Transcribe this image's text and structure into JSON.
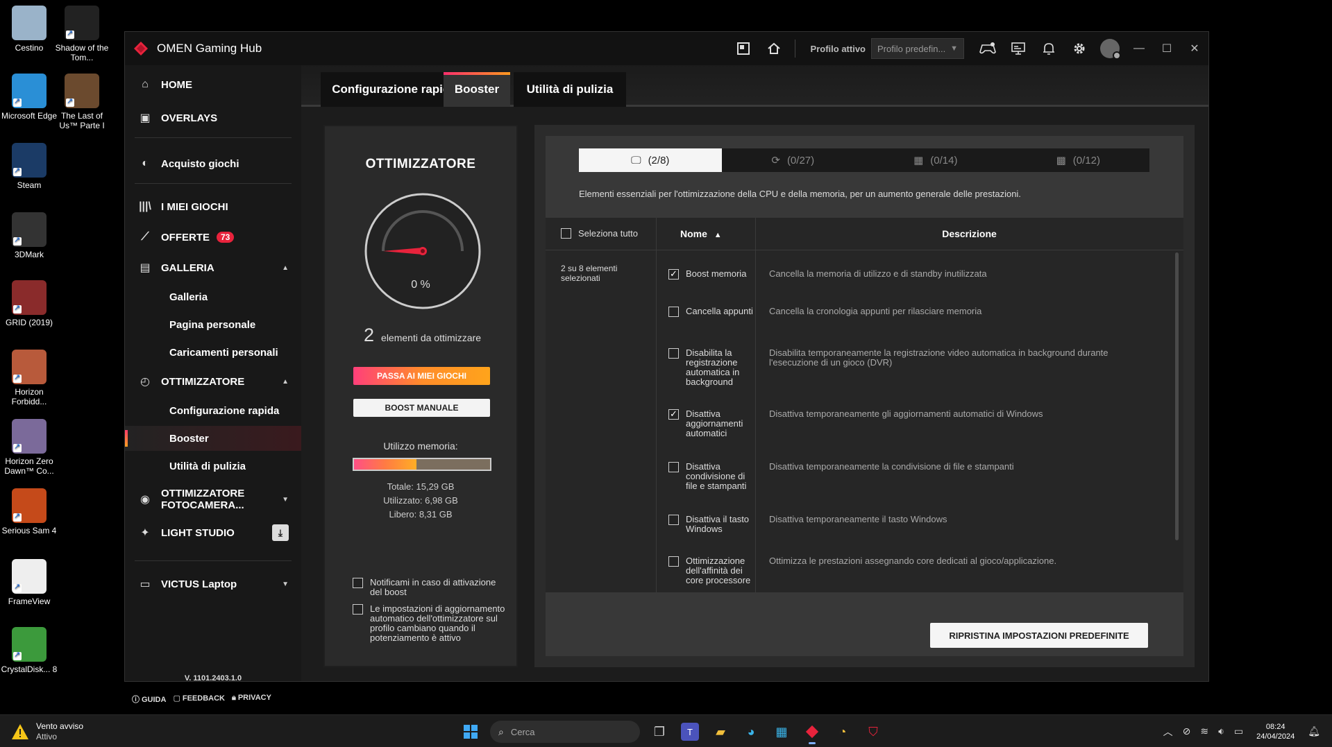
{
  "desktop": {
    "icons": [
      {
        "label": "Cestino",
        "color": "#9ab3c9"
      },
      {
        "label": "Shadow of the Tom...",
        "color": "#222"
      },
      {
        "label": "Microsoft Edge",
        "color": "#2a8fd6"
      },
      {
        "label": "The Last of Us™ Parte I",
        "color": "#6b4a2e"
      },
      {
        "label": "Steam",
        "color": "#1b3b66"
      },
      {
        "label": "3DMark",
        "color": "#333"
      },
      {
        "label": "GRID (2019)",
        "color": "#8a2b2b"
      },
      {
        "label": "Horizon Forbidd...",
        "color": "#b85a3b"
      },
      {
        "label": "Horizon Zero Dawn™ Co...",
        "color": "#7b6a9a"
      },
      {
        "label": "Serious Sam 4",
        "color": "#c54a1a"
      },
      {
        "label": "FrameView",
        "color": "#eee"
      },
      {
        "label": "CrystalDisk... 8",
        "color": "#3c9a3c"
      }
    ]
  },
  "window": {
    "title": "OMEN Gaming Hub",
    "profile_label": "Profilo attivo",
    "profile_value": "Profilo predefin..."
  },
  "sidebar": {
    "home": "HOME",
    "overlays": "OVERLAYS",
    "acquisto": "Acquisto giochi",
    "miei_giochi": "I MIEI GIOCHI",
    "offerte": "OFFERTE",
    "offerte_badge": "73",
    "galleria": "GALLERIA",
    "galleria_sub": [
      "Galleria",
      "Pagina personale",
      "Caricamenti personali"
    ],
    "ottimizzatore": "OTTIMIZZATORE",
    "ottimizzatore_sub": [
      "Configurazione rapida",
      "Booster",
      "Utilità di pulizia"
    ],
    "fotocamera_1": "OTTIMIZZATORE",
    "fotocamera_2": "FOTOCAMERA...",
    "light_studio": "LIGHT STUDIO",
    "device": "VICTUS Laptop",
    "version": "V. 1101.2403.1.0",
    "guida": "GUIDA",
    "feedback": "FEEDBACK",
    "privacy": "PRIVACY"
  },
  "tabs": [
    "Configurazione rapida",
    "Booster",
    "Utilità di pulizia"
  ],
  "optimizer": {
    "title": "OTTIMIZZATORE",
    "gauge_value": "0 %",
    "count": "2",
    "count_text": "elementi da ottimizzare",
    "btn_games": "PASSA AI MIEI GIOCHI",
    "btn_manual": "BOOST MANUALE",
    "mem_label": "Utilizzo memoria:",
    "mem_used_fraction": 0.457,
    "mem_total": "Totale: 15,29 GB",
    "mem_used": "Utilizzato: 6,98 GB",
    "mem_free": "Libero: 8,31 GB",
    "opt_notify": "Notificami in caso di attivazione del boost",
    "opt_auto": "Le impostazioni di aggiornamento automatico dell'ottimizzatore sul profilo cambiano quando il potenziamento è attivo"
  },
  "booster": {
    "segments": [
      "(2/8)",
      "(0/27)",
      "(0/14)",
      "(0/12)"
    ],
    "description": "Elementi essenziali per l'ottimizzazione della CPU e della memoria, per un aumento generale delle prestazioni.",
    "select_all": "Seleziona tutto",
    "col_name": "Nome",
    "col_desc": "Descrizione",
    "selected_info": "2 su 8 elementi selezionati",
    "rows": [
      {
        "name": "Boost memoria",
        "desc": "Cancella la memoria di utilizzo e di standby inutilizzata",
        "checked": true
      },
      {
        "name": "Cancella appunti",
        "desc": "Cancella la cronologia appunti per rilasciare memoria",
        "checked": false
      },
      {
        "name": "Disabilita la registrazione automatica in background",
        "desc": "Disabilita temporaneamente la registrazione video automatica in background durante l'esecuzione di un gioco (DVR)",
        "checked": false
      },
      {
        "name": "Disattiva aggiornamenti automatici",
        "desc": "Disattiva temporaneamente gli aggiornamenti automatici di Windows",
        "checked": true
      },
      {
        "name": "Disattiva condivisione di file e stampanti",
        "desc": "Disattiva temporaneamente la condivisione di file e stampanti",
        "checked": false
      },
      {
        "name": "Disattiva il tasto Windows",
        "desc": "Disattiva temporaneamente il tasto Windows",
        "checked": false
      },
      {
        "name": "Ottimizzazione dell'affinità dei core processore",
        "desc": "Ottimizza le prestazioni assegnando core dedicati al gioco/applicazione.",
        "checked": false
      }
    ],
    "reset_button": "RIPRISTINA IMPOSTAZIONI PREDEFINITE"
  },
  "taskbar": {
    "weather_title": "Vento avviso",
    "weather_status": "Attivo",
    "search_placeholder": "Cerca",
    "time": "08:24",
    "date": "24/04/2024"
  }
}
